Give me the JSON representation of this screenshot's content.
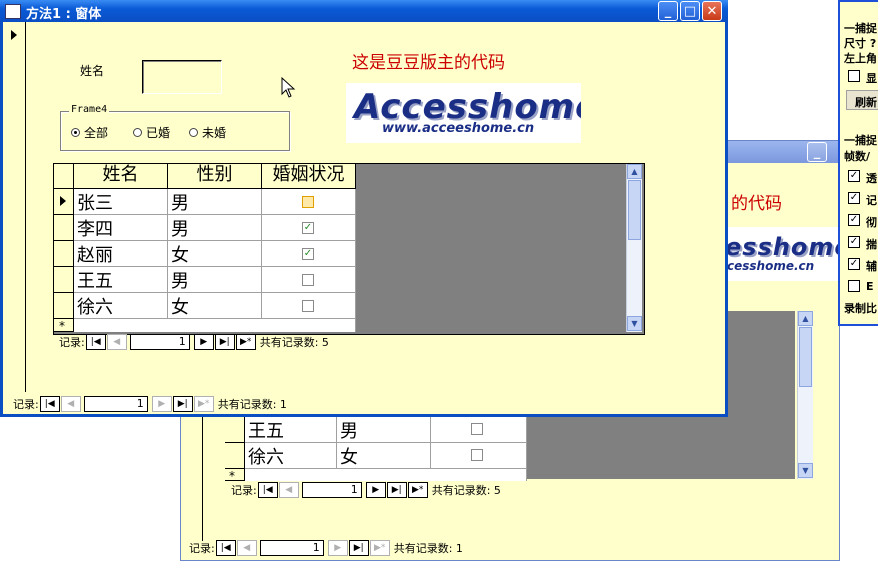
{
  "front_window": {
    "title": "方法1 : 窗体",
    "label_name": "姓名",
    "red_caption": "这是豆豆版主的代码",
    "logo_word": "Accesshome",
    "logo_url": "www.acceeshome.cn",
    "frame_caption": "Frame4",
    "radios": [
      {
        "label": "全部",
        "selected": true
      },
      {
        "label": "已婚",
        "selected": false
      },
      {
        "label": "未婚",
        "selected": false
      }
    ],
    "grid": {
      "headers": [
        "姓名",
        "性别",
        "婚姻状况"
      ],
      "rows": [
        {
          "name": "张三",
          "gender": "男",
          "married": false
        },
        {
          "name": "李四",
          "gender": "男",
          "married": true
        },
        {
          "name": "赵丽",
          "gender": "女",
          "married": true
        },
        {
          "name": "王五",
          "gender": "男",
          "married": false
        },
        {
          "name": "徐六",
          "gender": "女",
          "married": false
        }
      ],
      "new_row_marker": "*"
    },
    "sub_nav": {
      "label": "记录:",
      "record": "1",
      "total": "共有记录数: 5"
    },
    "main_nav": {
      "label": "记录:",
      "record": "1",
      "total": "共有记录数: 1"
    }
  },
  "back_window": {
    "red_caption_partial": "的代码",
    "logo_word_partial": "esshome",
    "logo_url_partial": "cesshome.cn",
    "rows": [
      {
        "name": "王五",
        "gender": "男"
      },
      {
        "name": "徐六",
        "gender": "女"
      }
    ],
    "new_row_marker": "*",
    "sub_nav": {
      "label": "记录:",
      "record": "1",
      "total": "共有记录数: 5"
    },
    "main_nav": {
      "label": "记录:",
      "record": "1",
      "total": "共有记录数: 1"
    }
  },
  "tool_window": {
    "lines": [
      "一捕捉",
      "尺寸 ?",
      "左上角"
    ],
    "check1_label": "显",
    "refresh_label": "刷新",
    "section2": "一捕捉",
    "frames_label": "帧数/",
    "checks": [
      {
        "label": "透",
        "checked": true
      },
      {
        "label": "记",
        "checked": true
      },
      {
        "label": "彻",
        "checked": true
      },
      {
        "label": "揣",
        "checked": true
      },
      {
        "label": "辅",
        "checked": true
      },
      {
        "label": "E",
        "checked": false
      }
    ],
    "record_label": "录制比"
  },
  "colors": {
    "form_bg": "#ffffcc",
    "title_active": "#0a5ad6",
    "caption_red": "#cc0000",
    "logo_blue": "#1b2e86"
  }
}
